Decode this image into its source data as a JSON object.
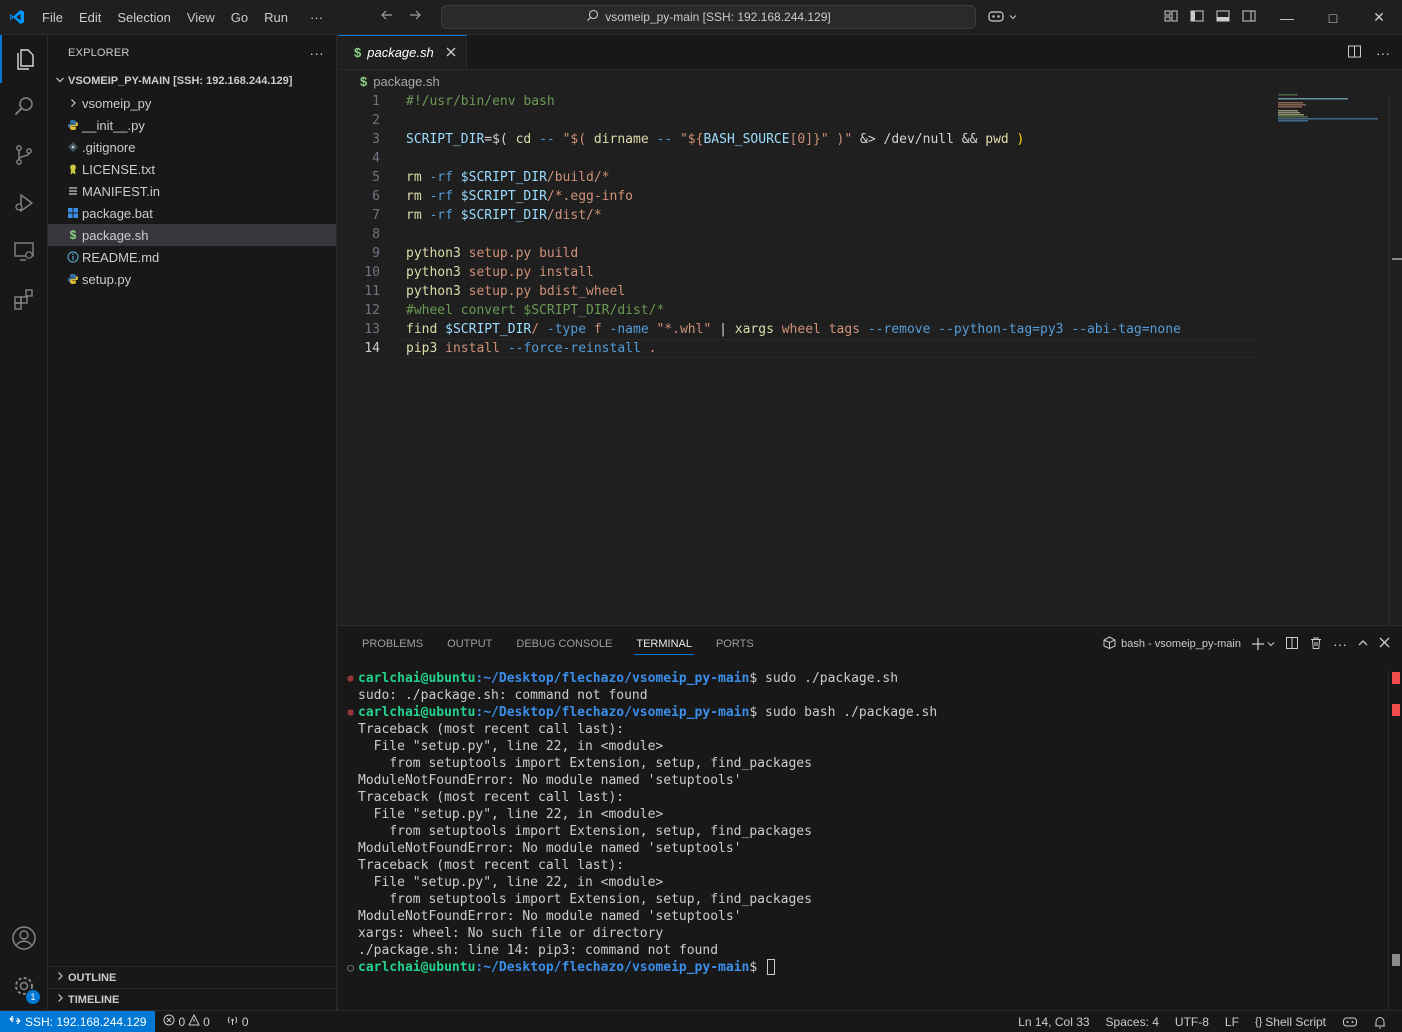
{
  "titlebar": {
    "menu": [
      "File",
      "Edit",
      "Selection",
      "View",
      "Go",
      "Run",
      "···"
    ],
    "search_text": "vsomeip_py-main [SSH: 192.168.244.129]"
  },
  "sidebar": {
    "title": "EXPLORER",
    "more": "···",
    "folder": "VSOMEIP_PY-MAIN [SSH: 192.168.244.129]",
    "items": [
      {
        "label": "vsomeip_py",
        "icon": "chevron-right-icon",
        "type": "folder"
      },
      {
        "label": "__init__.py",
        "icon": "python-icon",
        "type": "file"
      },
      {
        "label": ".gitignore",
        "icon": "git-icon",
        "type": "file"
      },
      {
        "label": "LICENSE.txt",
        "icon": "license-icon",
        "type": "file"
      },
      {
        "label": "MANIFEST.in",
        "icon": "lines-icon",
        "type": "file"
      },
      {
        "label": "package.bat",
        "icon": "windows-icon",
        "type": "file"
      },
      {
        "label": "package.sh",
        "icon": "dollar-icon",
        "type": "file",
        "selected": true
      },
      {
        "label": "README.md",
        "icon": "info-icon",
        "type": "file"
      },
      {
        "label": "setup.py",
        "icon": "python-icon",
        "type": "file"
      }
    ],
    "outline": "OUTLINE",
    "timeline": "TIMELINE"
  },
  "editor": {
    "tab_label": "package.sh",
    "tab_icon": "$",
    "breadcrumb": "package.sh",
    "current_line": 14,
    "lines": [
      "1",
      "2",
      "3",
      "4",
      "5",
      "6",
      "7",
      "8",
      "9",
      "10",
      "11",
      "12",
      "13",
      "14"
    ]
  },
  "code": {
    "l1": "#!/usr/bin/env bash",
    "l3a": "SCRIPT_DIR",
    "l3b": "=$( ",
    "l3c": "cd",
    "l3d": " -- ",
    "l3e": "\"$( ",
    "l3f": "dirname",
    "l3g": " -- ",
    "l3h": "\"${",
    "l3i": "BASH_SOURCE",
    "l3j": "[0]}\"",
    "l3k": " )\"",
    "l3l": " &> /dev/null && ",
    "l3m": "pwd",
    "l3n": " )",
    "rm": "rm",
    "rf": " -rf ",
    "sd": "$SCRIPT_DIR",
    "l5": "/build/*",
    "l6": "/*.egg-info",
    "l7": "/dist/*",
    "py": "python3",
    "setup": " setup.py ",
    "l9": "build",
    "l10": "install",
    "l11": "bdist_wheel",
    "l12": "#wheel convert $SCRIPT_DIR/dist/*",
    "l13a": "find",
    "l13b": " $SCRIPT_DIR",
    "l13c": "/ ",
    "l13d": "-type",
    "l13e": " f ",
    "l13f": "-name",
    "l13g": " \"*.whl\"",
    "l13h": " | ",
    "l13i": "xargs",
    "l13j": " wheel tags ",
    "l13k": "--remove --python-tag=py3 --abi-tag=none",
    "l14a": "pip3",
    "l14b": " install ",
    "l14c": "--force-reinstall",
    "l14d": " ."
  },
  "panel": {
    "tabs": [
      "PROBLEMS",
      "OUTPUT",
      "DEBUG CONSOLE",
      "TERMINAL",
      "PORTS"
    ],
    "active_tab": "TERMINAL",
    "terminal_name": "bash - vsomeip_py-main"
  },
  "terminal": {
    "user": "carlchai@ubuntu",
    "path": ":~/Desktop/flechazo/vsomeip_py-main",
    "cmd1": "$ sudo ./package.sh",
    "out1": "sudo: ./package.sh: command not found",
    "cmd2": "$ sudo bash ./package.sh",
    "tb": "Traceback (most recent call last):",
    "file": "  File \"setup.py\", line 22, in <module>",
    "from": "    from setuptools import Extension, setup, find_packages",
    "err": "ModuleNotFoundError: No module named 'setuptools'",
    "xargs": "xargs: wheel: No such file or directory",
    "pip": "./package.sh: line 14: pip3: command not found",
    "prompt_end": "$ "
  },
  "statusbar": {
    "remote": "SSH: 192.168.244.129",
    "errors": "0",
    "warnings": "0",
    "ports": "0",
    "position": "Ln 14, Col 33",
    "spaces": "Spaces: 4",
    "encoding": "UTF-8",
    "eol": "LF",
    "language": "Shell Script",
    "notif_badge": "1"
  },
  "colors": {
    "accent": "#0078d4",
    "error": "#f14c4c",
    "prompt_user": "#23d18b",
    "prompt_path": "#3b8eea"
  }
}
